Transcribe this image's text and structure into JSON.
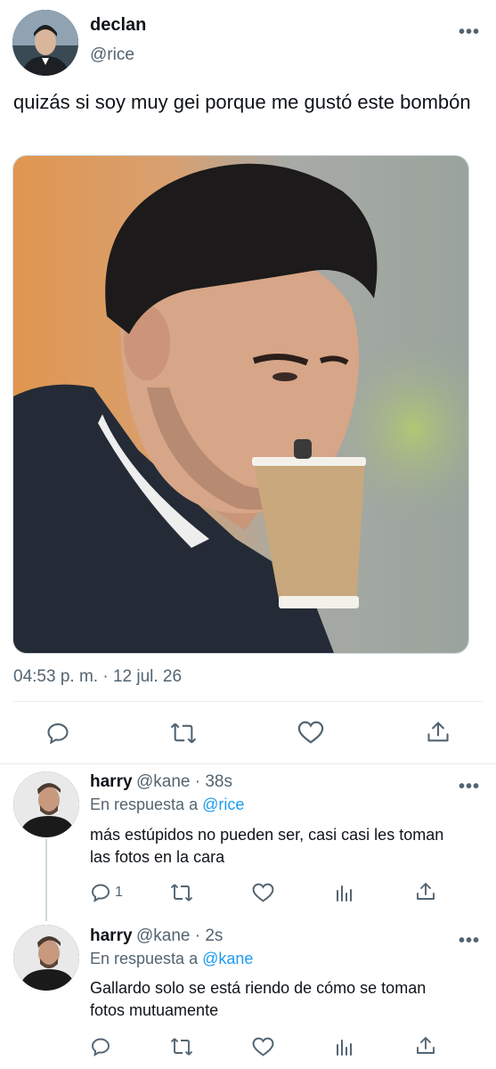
{
  "tweet": {
    "author_name": "declan",
    "author_handle": "@rice",
    "text": "quizás si soy muy gei porque me gustó este bombón",
    "timestamp": "04:53 p. m. · 12 jul. 26"
  },
  "replies": [
    {
      "name": "harry",
      "handle_time": "@kane · 38s",
      "reply_prefix": "En respuesta a",
      "reply_mention": "@rice",
      "text": "más estúpidos no pueden ser, casi casi les toman las fotos en la cara",
      "reply_count": "1"
    },
    {
      "name": "harry",
      "handle_time": "@kane · 2s",
      "reply_prefix": "En respuesta a",
      "reply_mention": "@kane",
      "text": "Gallardo solo se está riendo de cómo se toman fotos mutuamente",
      "reply_count": ""
    }
  ],
  "icons": {
    "actions": [
      "reply-icon",
      "retweet-icon",
      "like-icon",
      "share-icon",
      "analytics-icon",
      "more-icon"
    ]
  },
  "colors": {
    "link": "#1d9bf0",
    "secondary_text": "#536471",
    "divider": "#e6ecf0"
  }
}
